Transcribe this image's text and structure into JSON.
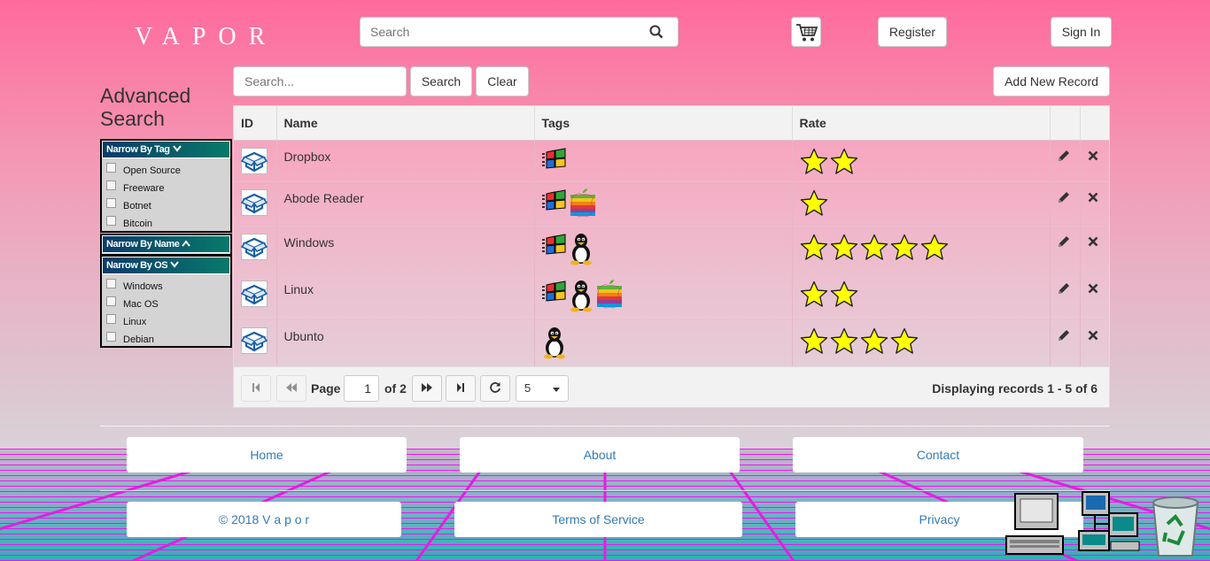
{
  "header": {
    "logo": "VAPOR",
    "search_placeholder": "Search",
    "register_label": "Register",
    "signin_label": "Sign In"
  },
  "sidebar": {
    "title": "Advanced Search",
    "tag_filter": {
      "label": "Narrow By Tag",
      "expanded": true,
      "options": [
        "Open Source",
        "Freeware",
        "Botnet",
        "Bitcoin"
      ]
    },
    "name_filter": {
      "label": "Narrow By Name",
      "expanded": false
    },
    "os_filter": {
      "label": "Narrow By OS",
      "expanded": true,
      "options": [
        "Windows",
        "Mac OS",
        "Linux",
        "Debian"
      ]
    }
  },
  "toolbar": {
    "search_placeholder": "Search...",
    "search_label": "Search",
    "clear_label": "Clear",
    "add_label": "Add New Record"
  },
  "grid": {
    "columns": [
      "ID",
      "Name",
      "Tags",
      "Rate",
      "",
      ""
    ],
    "rows": [
      {
        "name": "Dropbox",
        "tags": [
          "windows-icon"
        ],
        "rate": 2
      },
      {
        "name": "Abode Reader",
        "tags": [
          "windows-icon",
          "apple-icon"
        ],
        "rate": 1
      },
      {
        "name": "Windows",
        "tags": [
          "windows-icon",
          "linux-icon"
        ],
        "rate": 5
      },
      {
        "name": "Linux",
        "tags": [
          "windows-icon",
          "linux-icon",
          "apple-icon"
        ],
        "rate": 2
      },
      {
        "name": "Ubunto",
        "tags": [
          "linux-icon"
        ],
        "rate": 4
      }
    ],
    "pager": {
      "page_label": "Page",
      "page": "1",
      "of_label": "of 2",
      "page_size": "5",
      "status": "Displaying records 1 - 5 of 6"
    }
  },
  "footer": {
    "links_row1": [
      "Home",
      "About",
      "Contact"
    ],
    "links_row2": [
      "© 2018 V a p o r",
      "Terms of Service",
      "Privacy"
    ]
  },
  "colors": {
    "bg_top": "#ff6a9c",
    "link": "#337ab7",
    "star": "#ffff00",
    "filter_head": "#0a3a6a"
  }
}
